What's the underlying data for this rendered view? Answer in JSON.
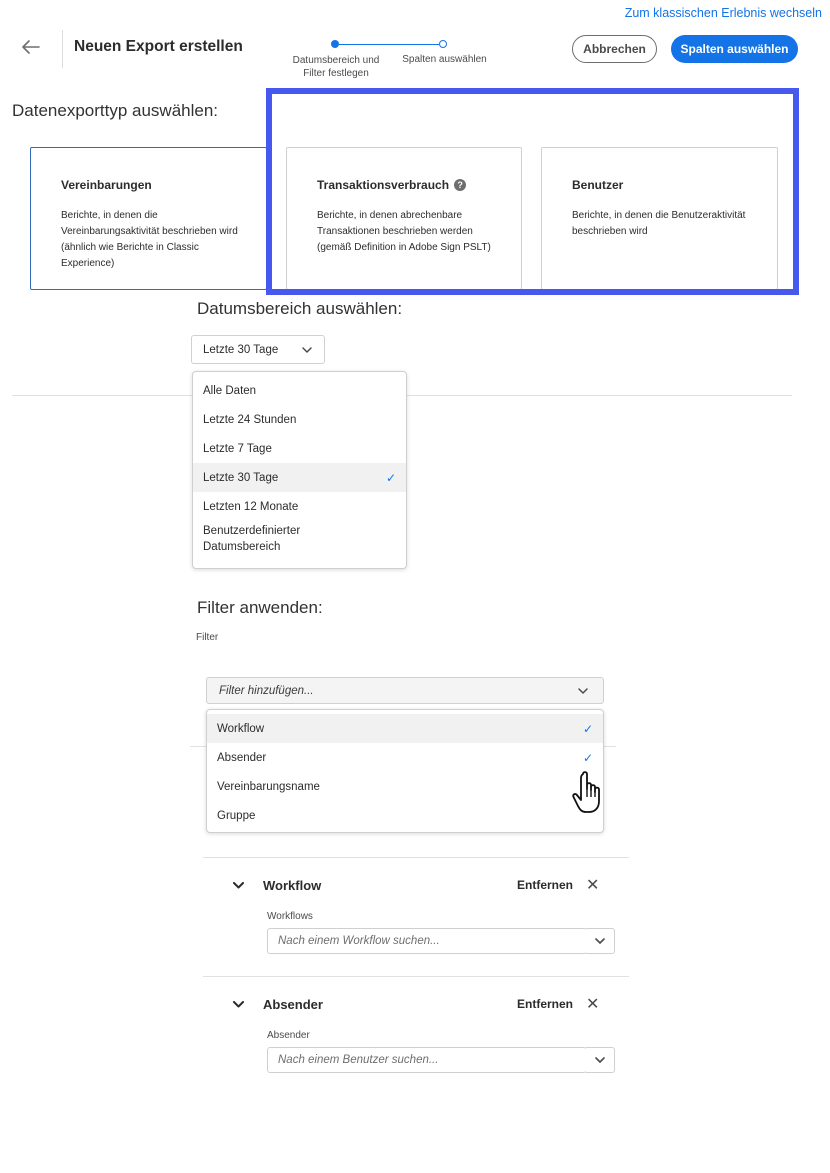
{
  "header": {
    "classic_link": "Zum klassischen Erlebnis wechseln",
    "title": "Neuen Export erstellen",
    "steps": [
      {
        "label": "Datumsbereich und Filter festlegen",
        "state": "current"
      },
      {
        "label": "Spalten auswählen",
        "state": "upcoming"
      }
    ],
    "cancel_label": "Abbrechen",
    "primary_label": "Spalten auswählen"
  },
  "export_type": {
    "heading": "Datenexporttyp auswählen:",
    "cards": [
      {
        "title": "Vereinbarungen",
        "description": "Berichte, in denen die Vereinbarungsaktivität beschrieben wird (ähnlich wie Berichte in Classic Experience)",
        "selected": true
      },
      {
        "title": "Transaktionsverbrauch",
        "description": "Berichte, in denen abrechenbare Transaktionen beschrieben werden (gemäß Definition in Adobe Sign PSLT)",
        "help_icon": "help-icon"
      },
      {
        "title": "Benutzer",
        "description": "Berichte, in denen die Benutzeraktivität beschrieben wird"
      }
    ]
  },
  "date_range": {
    "heading": "Datumsbereich auswählen:",
    "selected": "Letzte 30 Tage",
    "options": [
      {
        "label": "Alle Daten"
      },
      {
        "label": "Letzte 24 Stunden"
      },
      {
        "label": "Letzte 7 Tage"
      },
      {
        "label": "Letzte 30 Tage",
        "checked": true
      },
      {
        "label": "Letzten 12 Monate"
      },
      {
        "label": "Benutzerdefinierter Datumsbereich"
      }
    ]
  },
  "filters": {
    "heading": "Filter anwenden:",
    "label": "Filter",
    "add_placeholder": "Filter hinzufügen...",
    "options": [
      {
        "label": "Workflow",
        "checked": true
      },
      {
        "label": "Absender",
        "checked": true
      },
      {
        "label": "Vereinbarungsname"
      },
      {
        "label": "Gruppe"
      }
    ],
    "rows": [
      {
        "title": "Workflow",
        "remove": "Entfernen",
        "field_label": "Workflows",
        "placeholder": "Nach einem Workflow suchen..."
      },
      {
        "title": "Absender",
        "remove": "Entfernen",
        "field_label": "Absender",
        "placeholder": "Nach einem Benutzer suchen..."
      }
    ]
  },
  "colors": {
    "accent": "#1473e6",
    "highlight": "#4758f0",
    "selected_border": "#2f6bb8"
  },
  "icons": [
    "arrow-left-icon",
    "help-icon",
    "chevron-down-icon",
    "checkmark-icon",
    "close-icon",
    "hand-cursor-icon"
  ]
}
